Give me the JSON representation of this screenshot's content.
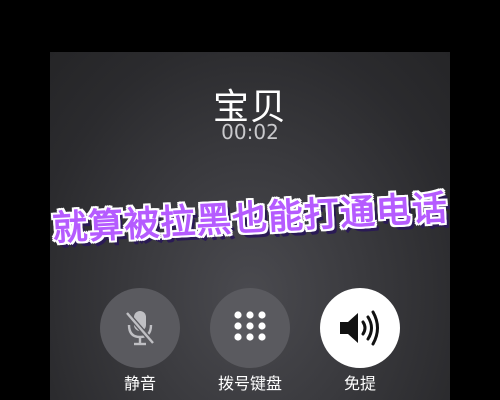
{
  "call": {
    "caller_name": "宝贝",
    "duration": "00:02"
  },
  "overlay": {
    "caption": "就算被拉黑也能打通电话",
    "color": "#b55bff"
  },
  "controls": [
    {
      "label": "静音",
      "icon": "mic-off-icon",
      "active": false
    },
    {
      "label": "拨号键盘",
      "icon": "keypad-icon",
      "active": false
    },
    {
      "label": "免提",
      "icon": "speaker-icon",
      "active": true
    }
  ],
  "colors": {
    "background": "#2b2b2e",
    "button": "#5a5a5f",
    "button_active": "#ffffff"
  }
}
